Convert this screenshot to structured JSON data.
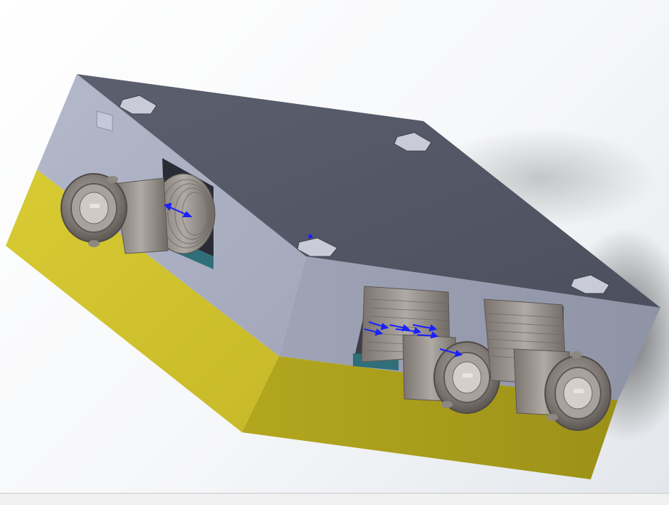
{
  "viewport": {
    "background_top": "#ffffff",
    "background_bottom": "#e3e6eb"
  },
  "model": {
    "top_face_color": "#545866",
    "side_face_light": "#a6aabd",
    "side_face_dark": "#9397aa",
    "base_color_light": "#d0c22c",
    "base_color_dark": "#a69a1a",
    "connector_color": "#8c8580",
    "connector_count": 3,
    "mounting_holes": 4,
    "annotation_color": "#1a20ff"
  },
  "status_bar": {
    "text": ""
  }
}
